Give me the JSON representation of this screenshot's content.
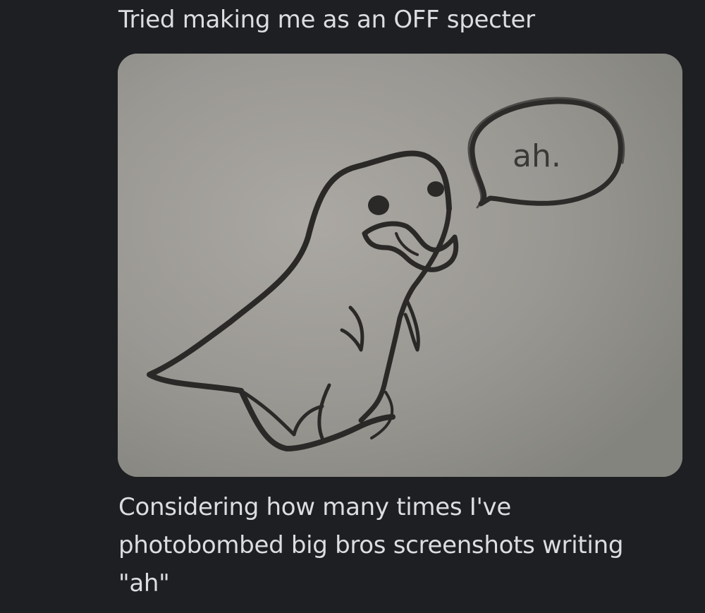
{
  "messages": {
    "top_text": "Tried making me as an OFF specter",
    "bottom_lines": [
      "Considering how many times I've",
      "photobombed big bros screenshots writing",
      "\"ah\""
    ]
  },
  "attachment": {
    "drawing_text": "ah."
  }
}
